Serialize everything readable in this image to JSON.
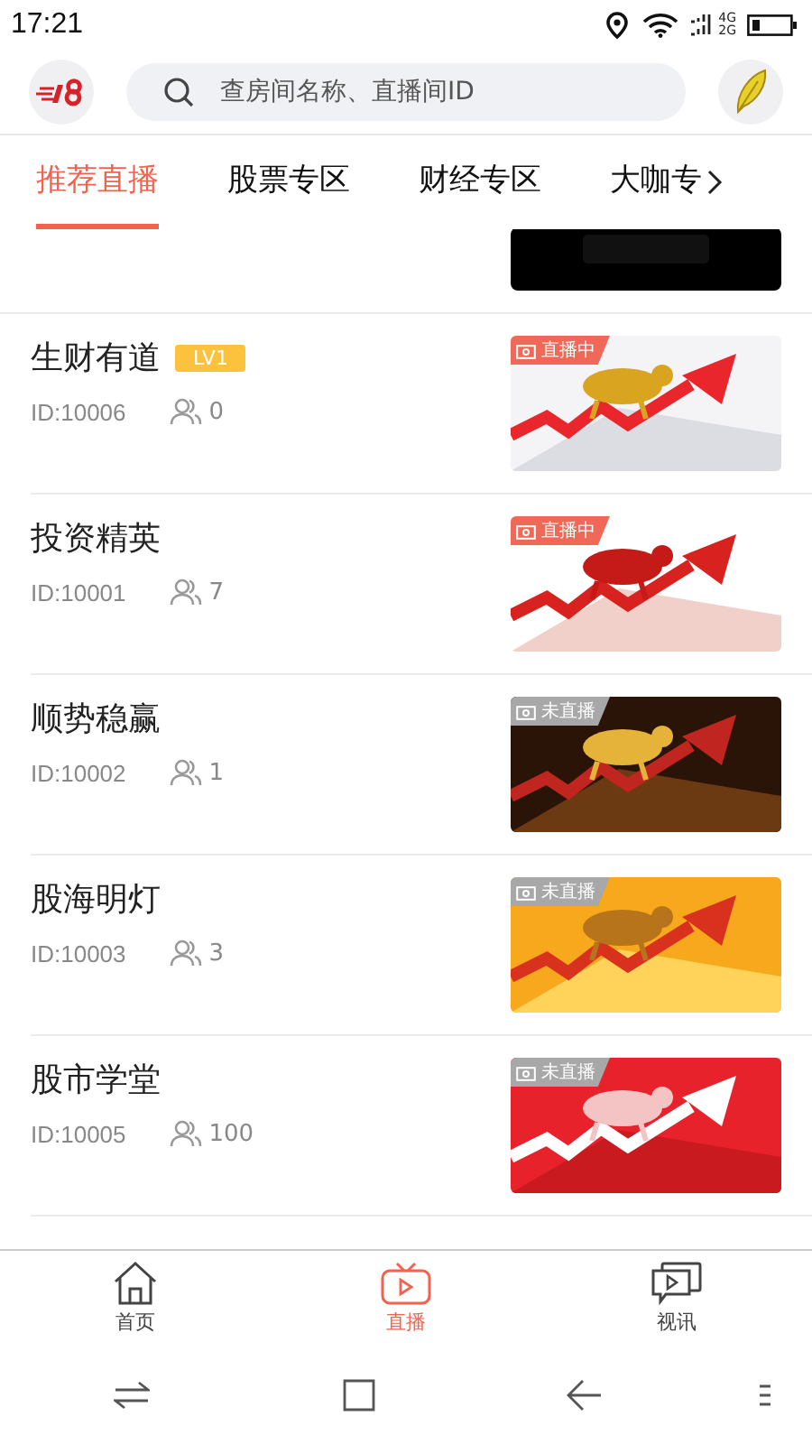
{
  "status_bar": {
    "time": "17:21",
    "network_top": "4G",
    "network_bottom": "2G"
  },
  "search": {
    "placeholder": "查房间名称、直播间ID"
  },
  "tabs": [
    {
      "label": "推荐直播",
      "selected": true
    },
    {
      "label": "股票专区",
      "selected": false
    },
    {
      "label": "财经专区",
      "selected": false
    },
    {
      "label": "大咖专",
      "selected": false
    }
  ],
  "rooms": [
    {
      "name": "生财有道",
      "level": "LV1",
      "id": "ID:10006",
      "viewers": "0",
      "live": true,
      "status": "直播中"
    },
    {
      "name": "投资精英",
      "id": "ID:10001",
      "viewers": "7",
      "live": true,
      "status": "直播中"
    },
    {
      "name": "顺势稳赢",
      "id": "ID:10002",
      "viewers": "1",
      "live": false,
      "status": "未直播"
    },
    {
      "name": "股海明灯",
      "id": "ID:10003",
      "viewers": "3",
      "live": false,
      "status": "未直播"
    },
    {
      "name": "股市学堂",
      "id": "ID:10005",
      "viewers": "100",
      "live": false,
      "status": "未直播"
    }
  ],
  "bottom_nav": [
    {
      "label": "首页",
      "kind": "home",
      "selected": false
    },
    {
      "label": "直播",
      "kind": "tv",
      "selected": true
    },
    {
      "label": "视讯",
      "kind": "chat",
      "selected": false
    }
  ]
}
